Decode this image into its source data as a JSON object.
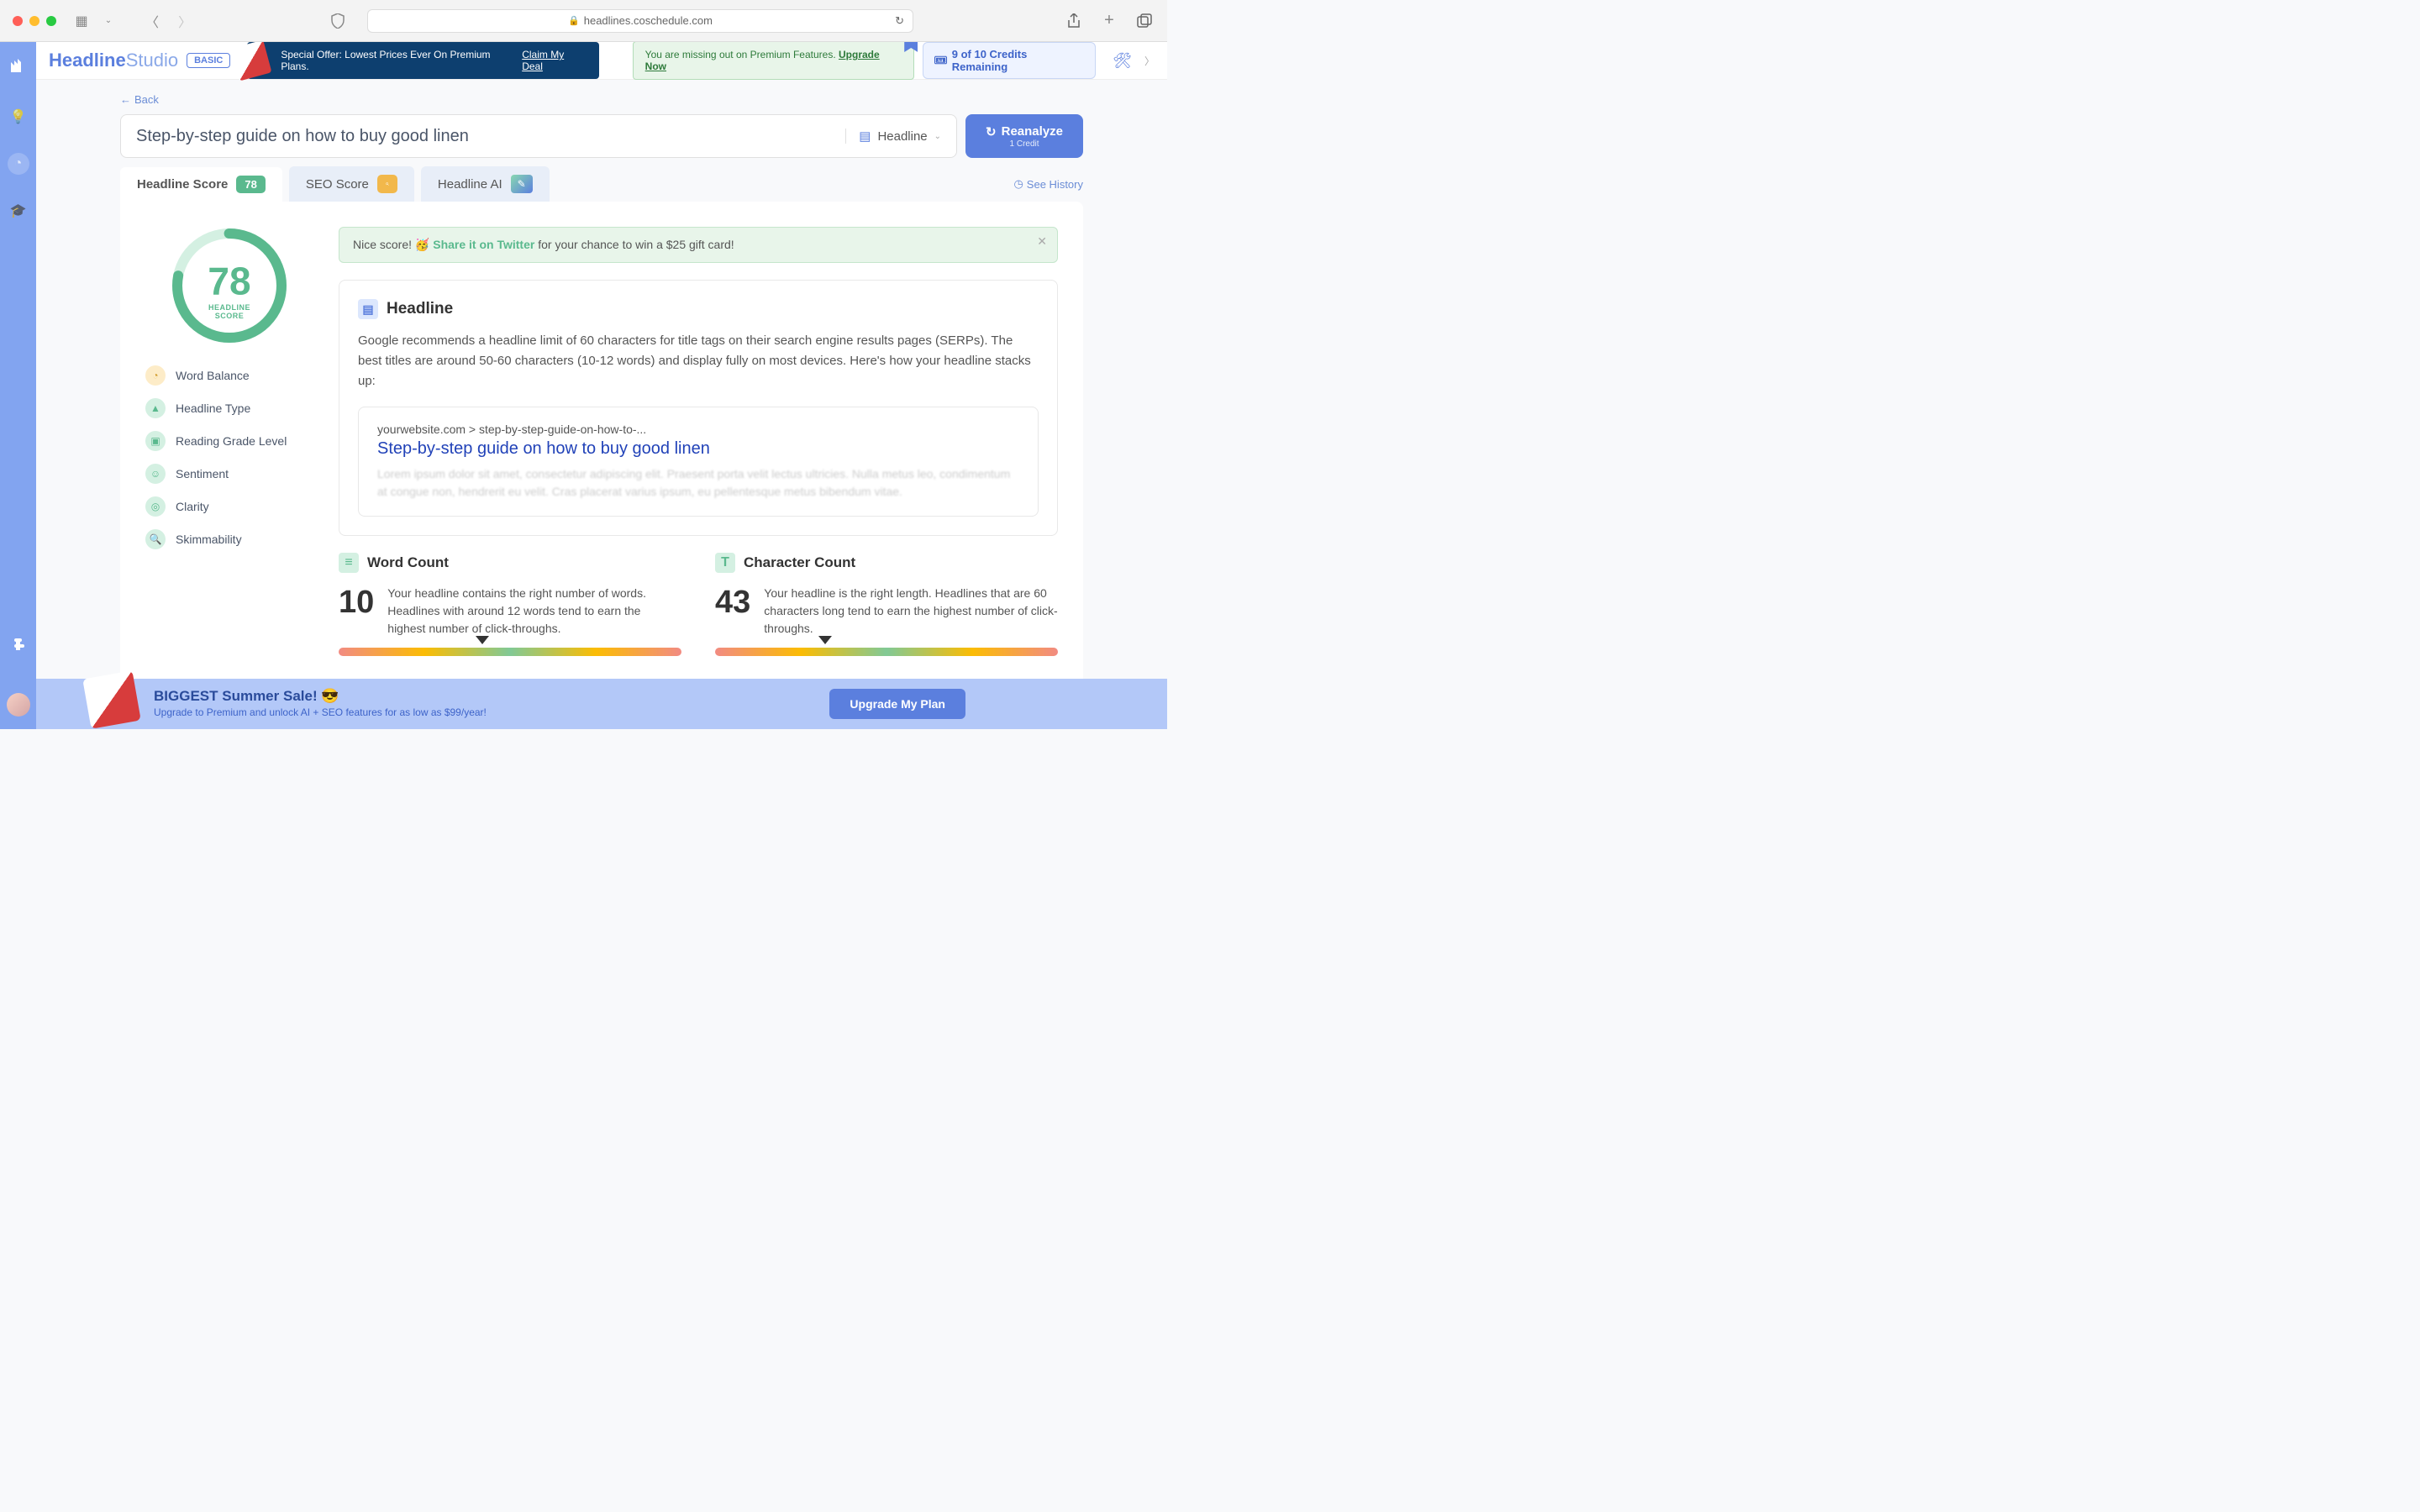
{
  "browser": {
    "url": "headlines.coschedule.com"
  },
  "brand": {
    "bold": "Headline",
    "light": "Studio",
    "badge": "BASIC"
  },
  "promo": {
    "text": "Special Offer: Lowest Prices Ever On Premium Plans. ",
    "link": "Claim My Deal"
  },
  "upgrade_notice": {
    "text": "You are missing out on Premium Features. ",
    "link": "Upgrade Now"
  },
  "credits": {
    "text": "9 of 10 Credits Remaining"
  },
  "back": "Back",
  "headline_input": "Step-by-step guide on how to buy good linen",
  "type_selector": "Headline",
  "reanalyze": {
    "title": "Reanalyze",
    "sub": "1 Credit"
  },
  "tabs": {
    "headline_score": "Headline Score",
    "headline_score_badge": "78",
    "seo_score": "SEO Score",
    "headline_ai": "Headline AI"
  },
  "see_history": "See History",
  "score": {
    "value": "78",
    "label1": "HEADLINE",
    "label2": "SCORE"
  },
  "metrics": [
    "Word Balance",
    "Headline Type",
    "Reading Grade Level",
    "Sentiment",
    "Clarity",
    "Skimmability"
  ],
  "twitter": {
    "pre": "Nice score! 🥳 ",
    "link": "Share it on Twitter",
    "post": " for your chance to win a $25 gift card!"
  },
  "headline_section": {
    "title": "Headline",
    "desc": "Google recommends a headline limit of 60 characters for title tags on their search engine results pages (SERPs). The best titles are around 50-60 characters (10-12 words) and display fully on most devices. Here's how your headline stacks up:",
    "serp_url": "yourwebsite.com > step-by-step-guide-on-how-to-...",
    "serp_title": "Step-by-step guide on how to buy good linen",
    "serp_desc": "Lorem ipsum dolor sit amet, consectetur adipiscing elit. Praesent porta velit lectus ultricies. Nulla metus leo, condimentum at congue non, hendrerit eu velit. Cras placerat varius ipsum, eu pellentesque metus bibendum vitae."
  },
  "word_count": {
    "title": "Word Count",
    "value": "10",
    "text": "Your headline contains the right number of words. Headlines with around 12 words tend to earn the highest number of click-throughs.",
    "pointer_pct": 42
  },
  "char_count": {
    "title": "Character Count",
    "value": "43",
    "text": "Your headline is the right length. Headlines that are 60 characters long tend to earn the highest number of click-throughs.",
    "pointer_pct": 32
  },
  "footer": {
    "title": "BIGGEST Summer Sale! 😎",
    "sub": "Upgrade to Premium and unlock AI + SEO features for as low as $99/year!",
    "btn": "Upgrade My Plan"
  }
}
